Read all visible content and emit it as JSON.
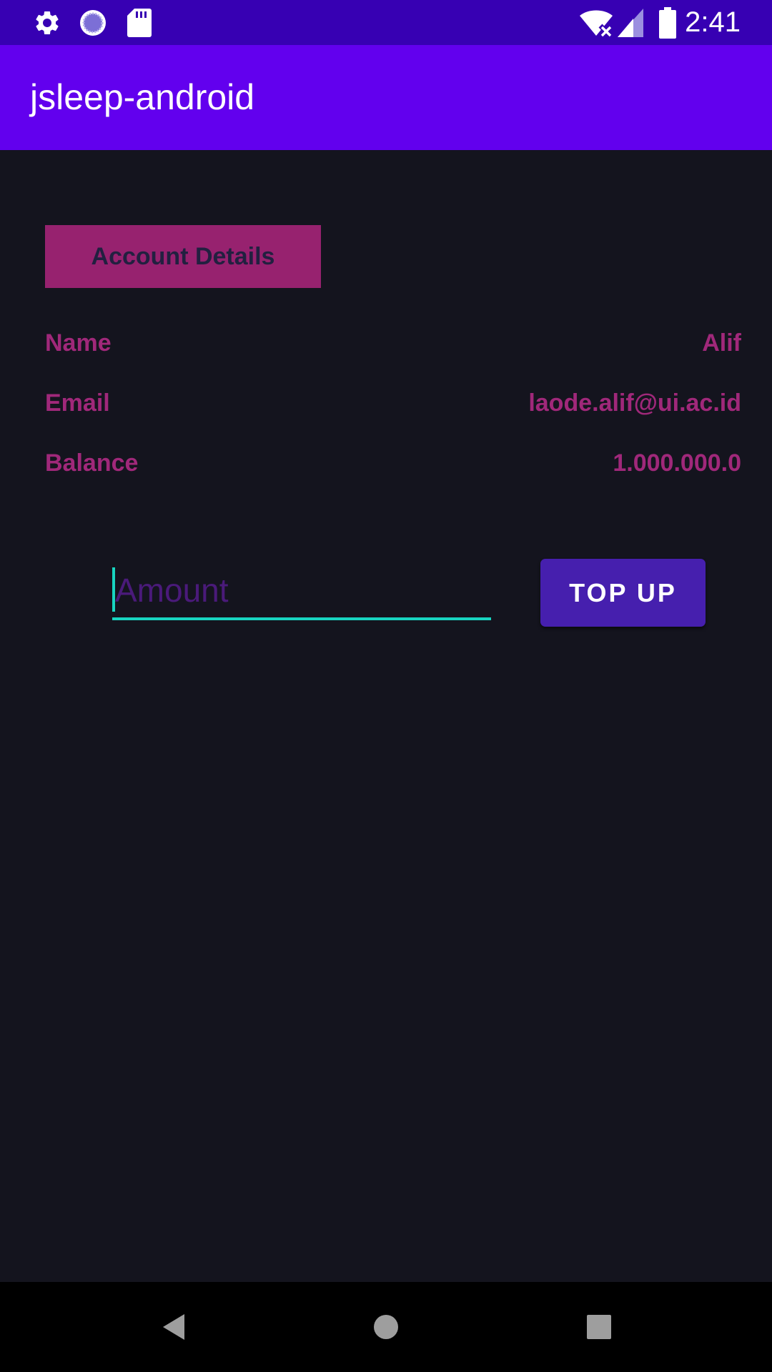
{
  "status_bar": {
    "time": "2:41",
    "left_icons": [
      "gear-icon",
      "sync-circle-icon",
      "sd-card-icon"
    ],
    "right_icons": [
      "wifi-off-icon",
      "cell-signal-icon",
      "battery-icon"
    ]
  },
  "app_bar": {
    "title": "jsleep-android"
  },
  "account": {
    "header": "Account Details",
    "rows": [
      {
        "label": "Name",
        "value": "Alif"
      },
      {
        "label": "Email",
        "value": "laode.alif@ui.ac.id"
      },
      {
        "label": "Balance",
        "value": "1.000.000.0"
      }
    ]
  },
  "topup": {
    "amount_placeholder": "Amount",
    "amount_value": "",
    "button_label": "TOP UP"
  },
  "colors": {
    "status_bar": "#3700b3",
    "app_bar": "#6200ee",
    "background": "#14141e",
    "accent_magenta": "#97226f",
    "field_underline": "#18d4c0",
    "button": "#461fae"
  },
  "nav_bar": {
    "icons": [
      "back-icon",
      "home-icon",
      "recents-icon"
    ]
  }
}
